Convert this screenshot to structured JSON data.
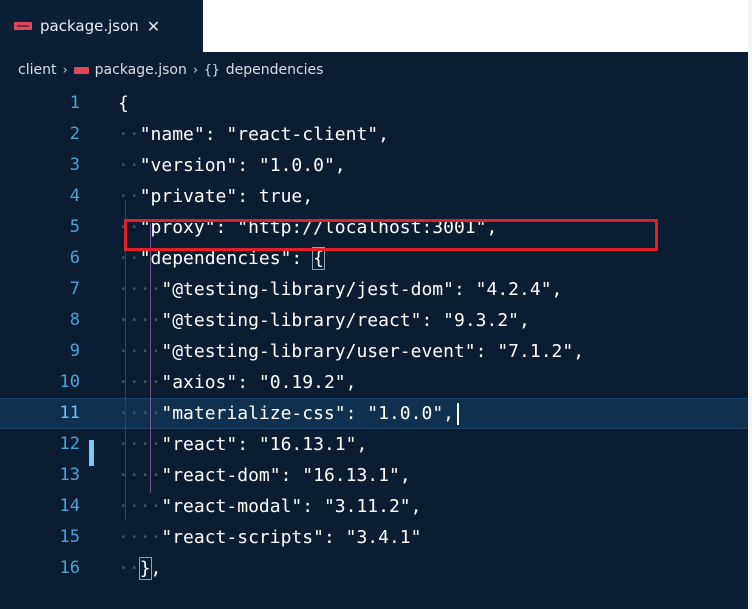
{
  "tab": {
    "filename": "package.json",
    "close_glyph": "✕"
  },
  "breadcrumbs": {
    "folder": "client",
    "file": "package.json",
    "braces": "{}",
    "symbol": "dependencies",
    "separator": "›"
  },
  "editor": {
    "lines": [
      {
        "n": "1",
        "indent": 0,
        "parts": [
          [
            "punct",
            "{"
          ]
        ]
      },
      {
        "n": "2",
        "indent": 1,
        "parts": [
          [
            "key",
            "\"name\""
          ],
          [
            "punct",
            ": "
          ],
          [
            "str",
            "\"react-client\""
          ],
          [
            "punct",
            ","
          ]
        ]
      },
      {
        "n": "3",
        "indent": 1,
        "parts": [
          [
            "key",
            "\"version\""
          ],
          [
            "punct",
            ": "
          ],
          [
            "str",
            "\"1.0.0\""
          ],
          [
            "punct",
            ","
          ]
        ]
      },
      {
        "n": "4",
        "indent": 1,
        "parts": [
          [
            "key",
            "\"private\""
          ],
          [
            "punct",
            ": "
          ],
          [
            "bool",
            "true"
          ],
          [
            "punct",
            ","
          ]
        ]
      },
      {
        "n": "5",
        "indent": 1,
        "parts": [
          [
            "key",
            "\"proxy\""
          ],
          [
            "punct",
            ": "
          ],
          [
            "str",
            "\"http://localhost:3001\""
          ],
          [
            "punct",
            ","
          ]
        ]
      },
      {
        "n": "6",
        "indent": 1,
        "parts": [
          [
            "key",
            "\"dependencies\""
          ],
          [
            "punct",
            ": "
          ],
          [
            "bracehl",
            "{"
          ]
        ]
      },
      {
        "n": "7",
        "indent": 2,
        "parts": [
          [
            "key",
            "\"@testing-library/jest-dom\""
          ],
          [
            "punct",
            ": "
          ],
          [
            "str",
            "\"4.2.4\""
          ],
          [
            "punct",
            ","
          ]
        ]
      },
      {
        "n": "8",
        "indent": 2,
        "parts": [
          [
            "key",
            "\"@testing-library/react\""
          ],
          [
            "punct",
            ": "
          ],
          [
            "str",
            "\"9.3.2\""
          ],
          [
            "punct",
            ","
          ]
        ]
      },
      {
        "n": "9",
        "indent": 2,
        "parts": [
          [
            "key",
            "\"@testing-library/user-event\""
          ],
          [
            "punct",
            ": "
          ],
          [
            "str",
            "\"7.1.2\""
          ],
          [
            "punct",
            ","
          ]
        ]
      },
      {
        "n": "10",
        "indent": 2,
        "parts": [
          [
            "key",
            "\"axios\""
          ],
          [
            "punct",
            ": "
          ],
          [
            "str",
            "\"0.19.2\""
          ],
          [
            "punct",
            ","
          ]
        ]
      },
      {
        "n": "11",
        "indent": 2,
        "parts": [
          [
            "key",
            "\"materialize-css\""
          ],
          [
            "punct",
            ": "
          ],
          [
            "str",
            "\"1.0.0\""
          ],
          [
            "punct",
            ","
          ],
          [
            "cursor",
            ""
          ]
        ],
        "active": true
      },
      {
        "n": "12",
        "indent": 2,
        "parts": [
          [
            "key",
            "\"react\""
          ],
          [
            "punct",
            ": "
          ],
          [
            "str",
            "\"16.13.1\""
          ],
          [
            "punct",
            ","
          ]
        ]
      },
      {
        "n": "13",
        "indent": 2,
        "parts": [
          [
            "key",
            "\"react-dom\""
          ],
          [
            "punct",
            ": "
          ],
          [
            "str",
            "\"16.13.1\""
          ],
          [
            "punct",
            ","
          ]
        ]
      },
      {
        "n": "14",
        "indent": 2,
        "parts": [
          [
            "key",
            "\"react-modal\""
          ],
          [
            "punct",
            ": "
          ],
          [
            "str",
            "\"3.11.2\""
          ],
          [
            "punct",
            ","
          ]
        ]
      },
      {
        "n": "15",
        "indent": 2,
        "parts": [
          [
            "key",
            "\"react-scripts\""
          ],
          [
            "punct",
            ": "
          ],
          [
            "str",
            "\"3.4.1\""
          ]
        ]
      },
      {
        "n": "16",
        "indent": 1,
        "parts": [
          [
            "bracehl",
            "}"
          ],
          [
            "punct",
            ","
          ]
        ]
      }
    ]
  },
  "colors": {
    "background": "#0b1d33",
    "line_number": "#4ba3d8",
    "highlight_box": "#e01f26",
    "json_icon": "#e0485a"
  }
}
